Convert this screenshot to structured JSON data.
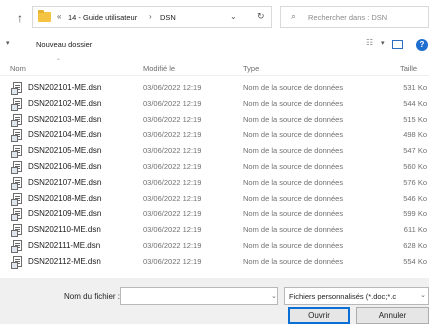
{
  "address": {
    "breadcrumb_prefix": "«",
    "folder1": "14 - Guide utilisateur",
    "separator": "›",
    "folder2": "DSN",
    "search_placeholder": "Rechercher dans : DSN"
  },
  "toolbar": {
    "new_folder": "Nouveau dossier",
    "help": "?"
  },
  "columns": {
    "name": "Nom",
    "modified": "Modifié le",
    "type": "Type",
    "size": "Taille"
  },
  "files": [
    {
      "name": "DSN202101-ME.dsn",
      "date": "03/06/2022 12:19",
      "type": "Nom de la source de données",
      "size": "531 Ko"
    },
    {
      "name": "DSN202102-ME.dsn",
      "date": "03/06/2022 12:19",
      "type": "Nom de la source de données",
      "size": "544 Ko"
    },
    {
      "name": "DSN202103-ME.dsn",
      "date": "03/06/2022 12:19",
      "type": "Nom de la source de données",
      "size": "515 Ko"
    },
    {
      "name": "DSN202104-ME.dsn",
      "date": "03/06/2022 12:19",
      "type": "Nom de la source de données",
      "size": "498 Ko"
    },
    {
      "name": "DSN202105-ME.dsn",
      "date": "03/06/2022 12:19",
      "type": "Nom de la source de données",
      "size": "547 Ko"
    },
    {
      "name": "DSN202106-ME.dsn",
      "date": "03/06/2022 12:19",
      "type": "Nom de la source de données",
      "size": "560 Ko"
    },
    {
      "name": "DSN202107-ME.dsn",
      "date": "03/06/2022 12:19",
      "type": "Nom de la source de données",
      "size": "576 Ko"
    },
    {
      "name": "DSN202108-ME.dsn",
      "date": "03/06/2022 12:19",
      "type": "Nom de la source de données",
      "size": "546 Ko"
    },
    {
      "name": "DSN202109-ME.dsn",
      "date": "03/06/2022 12:19",
      "type": "Nom de la source de données",
      "size": "599 Ko"
    },
    {
      "name": "DSN202110-ME.dsn",
      "date": "03/06/2022 12:19",
      "type": "Nom de la source de données",
      "size": "611 Ko"
    },
    {
      "name": "DSN202111-ME.dsn",
      "date": "03/06/2022 12:19",
      "type": "Nom de la source de données",
      "size": "628 Ko"
    },
    {
      "name": "DSN202112-ME.dsn",
      "date": "03/06/2022 12:19",
      "type": "Nom de la source de données",
      "size": "554 Ko"
    }
  ],
  "bottom": {
    "filename_label": "Nom du fichier :",
    "filename_value": "",
    "filter_selected": "Fichiers personnalisés (*.doc;*.c",
    "open_button": "Ouvrir",
    "cancel_button": "Annuler"
  }
}
